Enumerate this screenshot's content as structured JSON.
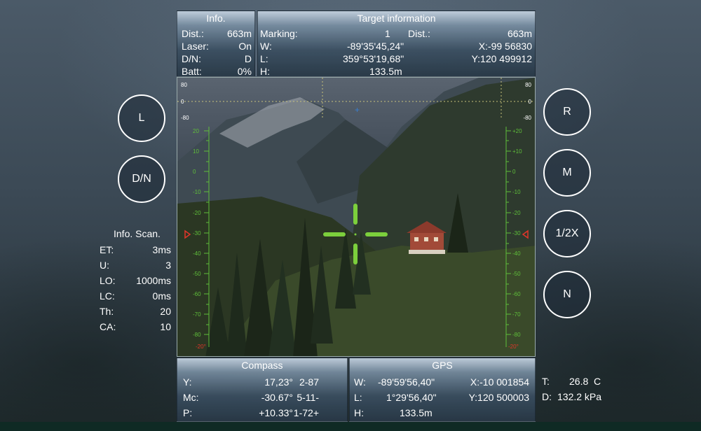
{
  "info": {
    "title": "Info.",
    "rows": [
      {
        "label": "Dist.:",
        "value": "663m"
      },
      {
        "label": "Laser:",
        "value": "On"
      },
      {
        "label": "D/N:",
        "value": "D"
      },
      {
        "label": "Batt:",
        "value": "0%"
      }
    ]
  },
  "target": {
    "title": "Target information",
    "marking_label": "Marking:",
    "marking_value": "1",
    "dist_label": "Dist.:",
    "dist_value": "663m",
    "w_label": "W:",
    "w_value": "-89'35'45,24\"",
    "x_value": "X:-99 56830",
    "l_label": "L:",
    "l_value": "359°53'19,68\"",
    "y_value": "Y:120 499912",
    "h_label": "H:",
    "h_value": "133.5m"
  },
  "scale": {
    "top_labels": [
      "80",
      "0",
      "-80"
    ],
    "left_ticks": [
      "20",
      "10",
      "0",
      "-10",
      "-20",
      "-30",
      "-40",
      "-50",
      "-60",
      "-70",
      "-80"
    ],
    "right_ticks": [
      "+20",
      "+10",
      "0",
      "-10",
      "-20",
      "-30",
      "-40",
      "-50",
      "-60",
      "-70",
      "-80"
    ],
    "bottom_left": "-20°",
    "bottom_right": "-20°",
    "marker_value": "-30"
  },
  "buttons": {
    "l": "L",
    "dn": "D/N",
    "r": "R",
    "m": "M",
    "zoom": "1/2X",
    "n": "N"
  },
  "scan": {
    "title": "Info. Scan.",
    "rows": [
      {
        "label": "ET:",
        "value": "3ms"
      },
      {
        "label": "U:",
        "value": "3"
      },
      {
        "label": "LO:",
        "value": "1000ms"
      },
      {
        "label": "LC:",
        "value": "0ms"
      },
      {
        "label": "Th:",
        "value": "20"
      },
      {
        "label": "CA:",
        "value": "10"
      }
    ]
  },
  "compass": {
    "title": "Compass",
    "rows": [
      {
        "label": "Y:",
        "value": "17,23°",
        "extra": "2-87"
      },
      {
        "label": "Mc:",
        "value": "-30.67°",
        "extra": "5-11-"
      },
      {
        "label": "P:",
        "value": "+10.33°",
        "extra": "1-72+"
      }
    ]
  },
  "gps": {
    "title": "GPS",
    "rows": [
      {
        "label": "W:",
        "value": "-89'59'56,40\"",
        "extra": "X:-10 001854"
      },
      {
        "label": "L:",
        "value": "1°29'56,40\"",
        "extra": "Y:120 500003"
      },
      {
        "label": "H:",
        "value": "133.5m",
        "extra": ""
      }
    ]
  },
  "env": {
    "t_label": "T:",
    "t_value": "26.8  C",
    "d_label": "D:",
    "d_value": "132.2 kPa"
  },
  "colors": {
    "scale_green": "#5fbf3a",
    "crosshair": "#7ccf3c",
    "marker_red": "#e0352a",
    "dotted_line": "#c8c27a"
  }
}
